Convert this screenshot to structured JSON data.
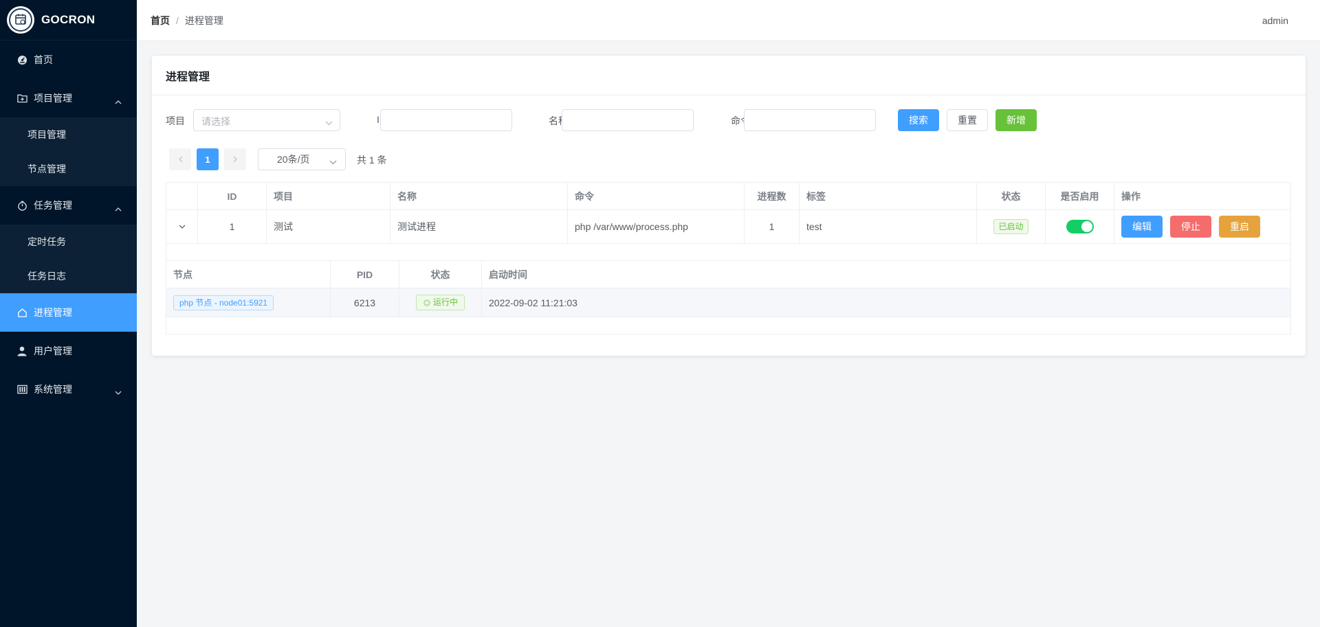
{
  "app": {
    "logo_text": "GOCRON"
  },
  "sidebar": {
    "items": [
      {
        "label": "首页",
        "icon": "dashboard-icon"
      },
      {
        "label": "项目管理",
        "icon": "folder-icon",
        "expanded": true,
        "children": [
          {
            "label": "项目管理"
          },
          {
            "label": "节点管理"
          }
        ]
      },
      {
        "label": "任务管理",
        "icon": "timer-icon",
        "expanded": true,
        "children": [
          {
            "label": "定时任务"
          },
          {
            "label": "任务日志"
          }
        ]
      },
      {
        "label": "进程管理",
        "icon": "home-icon",
        "active": true
      },
      {
        "label": "用户管理",
        "icon": "user-icon"
      },
      {
        "label": "系统管理",
        "icon": "building-icon",
        "expanded": false
      }
    ]
  },
  "header": {
    "breadcrumb": {
      "home": "首页",
      "separator": "/",
      "current": "进程管理"
    },
    "user": "admin"
  },
  "card": {
    "title": "进程管理"
  },
  "filter": {
    "project_label": "项目",
    "project_placeholder": "请选择",
    "id_label": "ID",
    "name_label": "名称",
    "command_label": "命令",
    "search_button": "搜索",
    "reset_button": "重置",
    "add_button": "新增"
  },
  "pagination": {
    "current_page": "1",
    "page_size": "20条/页",
    "total": "共 1 条"
  },
  "table": {
    "columns": [
      "",
      "ID",
      "项目",
      "名称",
      "命令",
      "进程数",
      "标签",
      "状态",
      "是否启用",
      "操作"
    ],
    "rows": [
      {
        "id": "1",
        "project": "测试",
        "name": "测试进程",
        "command": "php /var/www/process.php",
        "process_count": "1",
        "tag": "test",
        "status": "已启动",
        "enabled": true,
        "actions": {
          "edit": "编辑",
          "stop": "停止",
          "restart": "重启"
        }
      }
    ],
    "expanded": {
      "columns": [
        "节点",
        "PID",
        "状态",
        "启动时间"
      ],
      "rows": [
        {
          "node": "php 节点 - node01:5921",
          "pid": "6213",
          "status": "运行中",
          "start_time": "2022-09-02 11:21:03"
        }
      ]
    }
  },
  "colors": {
    "sidebar_bg": "#001529",
    "primary": "#409eff",
    "success": "#67c23a",
    "danger": "#f56c6c",
    "warning": "#e6a23c",
    "switch_on": "#13ce66"
  }
}
